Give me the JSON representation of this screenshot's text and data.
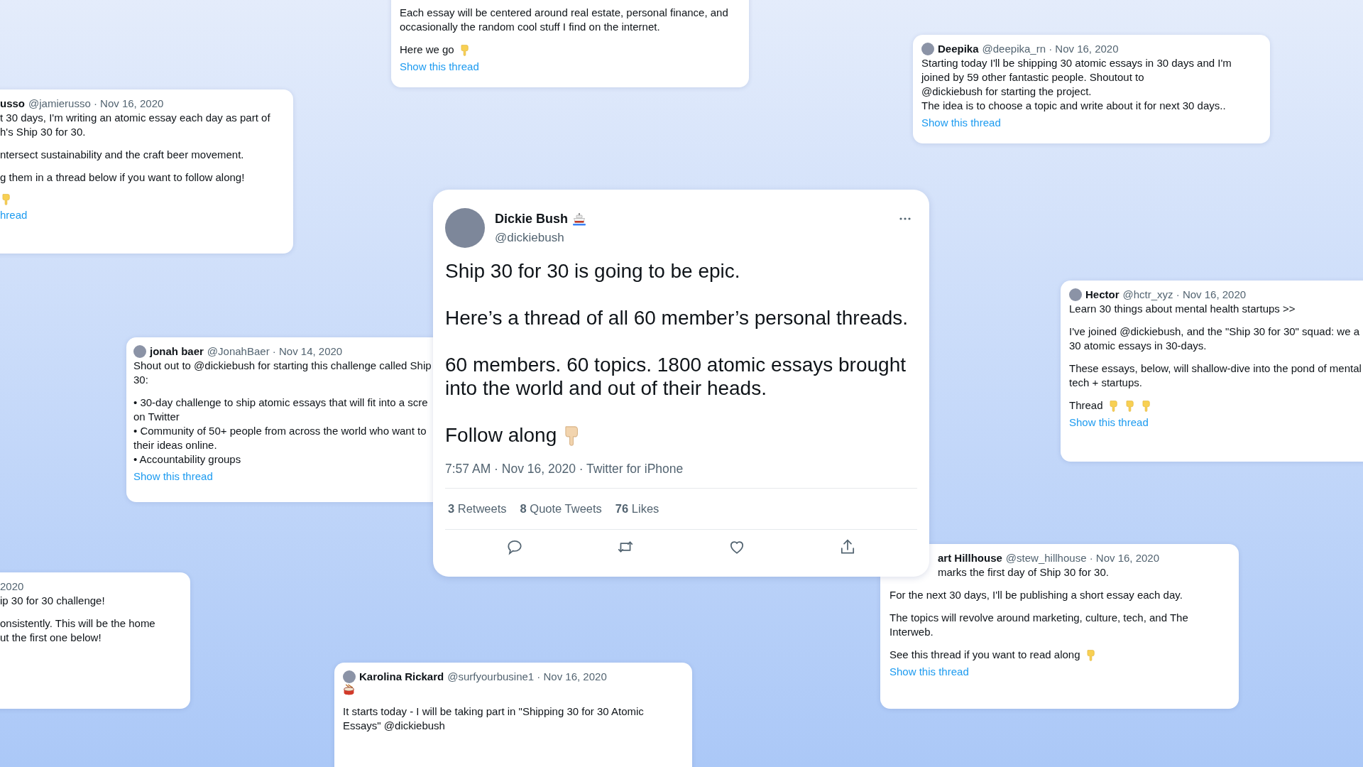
{
  "cards": [
    {
      "avatar": false,
      "paragraphs": [
        {
          "lines": [
            "Each essay will be centered around real estate, personal finance, and",
            "occasionally the random cool stuff I find on the internet."
          ]
        },
        {
          "lines": [
            "Here we go"
          ]
        }
      ],
      "link": "Show this thread"
    },
    {
      "avatar": true,
      "name": "Deepika",
      "handle_date": "@deepika_rn · Nov 16, 2020",
      "paragraphs": [
        {
          "lines": [
            "Starting today I'll be shipping 30 atomic essays in 30 days and I'm",
            "joined by 59 other fantastic people. Shoutout to",
            "@dickiebush for starting the project.",
            "The idea is to choose a topic and write about it for next 30 days.."
          ]
        }
      ],
      "link": "Show this thread"
    },
    {
      "avatar": false,
      "name": "usso",
      "handle_date": "@jamierusso · Nov 16, 2020",
      "paragraphs": [
        {
          "lines": [
            "t 30 days, I'm writing an atomic essay each day as part of",
            "h's Ship 30 for 30."
          ]
        },
        {
          "lines": [
            "ntersect sustainability and the craft beer movement."
          ]
        },
        {
          "lines": [
            "g them in a thread below if you want to follow along!"
          ]
        }
      ],
      "link": "hread"
    },
    {
      "avatar": true,
      "name": "jonah baer",
      "handle_date": "@JonahBaer · Nov 14, 2020",
      "paragraphs": [
        {
          "lines": [
            "Shout out to @dickiebush for starting this challenge called Ship",
            "30:"
          ]
        },
        {
          "lines": [
            "• 30-day challenge to ship atomic essays that will fit into a scre",
            "on Twitter",
            "• Community of 50+ people from across the world who want to",
            "their ideas online.",
            "• Accountability groups"
          ]
        }
      ],
      "link": "Show this thread"
    },
    {
      "avatar": true,
      "name": "Hector",
      "handle_date": "@hctr_xyz · Nov 16, 2020",
      "paragraphs": [
        {
          "lines": [
            "Learn 30 things about mental health startups >>"
          ]
        },
        {
          "lines": [
            "I've joined @dickiebush, and the \"Ship 30 for 30\" squad: we a",
            "30 atomic essays in 30-days."
          ]
        },
        {
          "lines": [
            "These essays, below, will shallow-dive into the pond of mental",
            "tech + startups."
          ]
        },
        {
          "lines": [
            "Thread"
          ]
        }
      ],
      "link": "Show this thread"
    },
    {
      "avatar": false,
      "handle_date": "2020",
      "paragraphs": [
        {
          "lines": [
            "ip 30 for 30 challenge!"
          ]
        },
        {
          "lines": [
            "onsistently. This will be the home",
            "ut the first one below!"
          ]
        }
      ]
    },
    {
      "avatar": true,
      "name": "Karolina Rickard",
      "handle_date": "@surfyourbusine1 · Nov 16, 2020",
      "paragraphs": [
        {
          "lines": [
            "It starts today - I will be taking part in \"Shipping 30 for 30 Atomic",
            "Essays\" @dickiebush"
          ]
        }
      ]
    },
    {
      "avatar": false,
      "name": "art Hillhouse",
      "handle_date": "@stew_hillhouse · Nov 16, 2020",
      "paragraphs": [
        {
          "lines": [
            "marks the first day of Ship 30 for 30."
          ]
        },
        {
          "lines": [
            "For the next 30 days, I'll be publishing a short essay each day."
          ]
        },
        {
          "lines": [
            "The topics will revolve around marketing, culture, tech, and The",
            "Interweb."
          ]
        },
        {
          "lines": [
            "See this thread if you want to read along"
          ]
        }
      ],
      "link": "Show this thread"
    }
  ],
  "main_tweet": {
    "name": "Dickie Bush",
    "handle": "@dickiebush",
    "paragraphs": [
      {
        "lines": [
          "Ship 30 for 30 is going to be epic."
        ]
      },
      {
        "lines": [
          "Here’s a thread of all 60 member’s personal threads."
        ]
      },
      {
        "lines": [
          "60 members. 60 topics. 1800 atomic essays brought",
          "into the world and out of their heads."
        ]
      },
      {
        "lines": [
          "Follow along"
        ]
      }
    ],
    "meta": "7:57 AM · Nov 16, 2020 · Twitter for iPhone",
    "stats": [
      "**3** Retweets",
      "**8** Quote Tweets",
      "**76** Likes"
    ]
  }
}
